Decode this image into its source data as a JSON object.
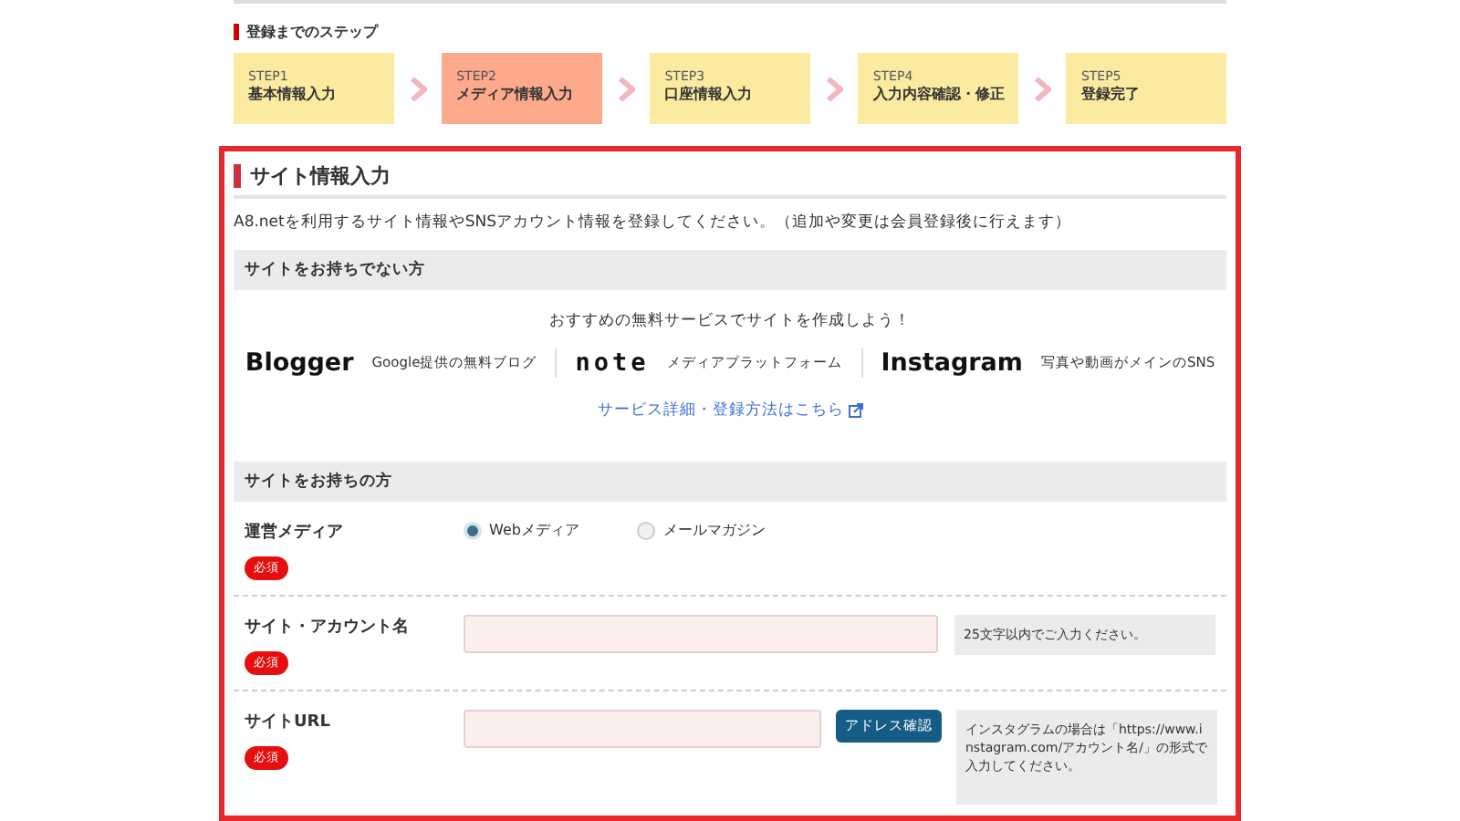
{
  "steps_heading": "登録までのステップ",
  "steps": [
    {
      "label": "STEP1",
      "title": "基本情報入力",
      "selected": false
    },
    {
      "label": "STEP2",
      "title": "メディア情報入力",
      "selected": true
    },
    {
      "label": "STEP3",
      "title": "口座情報入力",
      "selected": false
    },
    {
      "label": "STEP4",
      "title": "入力内容確認・修正",
      "selected": false
    },
    {
      "label": "STEP5",
      "title": "登録完了",
      "selected": false
    }
  ],
  "section": {
    "title": "サイト情報入力",
    "description": "A8.netを利用するサイト情報やSNSアカウント情報を登録してください。（追加や変更は会員登録後に行えます）",
    "no_site": {
      "heading": "サイトをお持ちでない方",
      "prompt": "おすすめの無料サービスでサイトを作成しよう！",
      "services": [
        {
          "name": "Blogger",
          "caption": "Google提供の無料ブログ"
        },
        {
          "name": "note",
          "caption": "メディアプラットフォーム"
        },
        {
          "name": "Instagram",
          "caption": "写真や動画がメインのSNS"
        }
      ],
      "link": "サービス詳細・登録方法はこちら"
    },
    "has_site": {
      "heading": "サイトをお持ちの方",
      "fields": [
        {
          "kind": "radio",
          "label": "運営メディア",
          "required": "必須",
          "options": [
            {
              "label": "Webメディア",
              "selected": true
            },
            {
              "label": "メールマガジン",
              "selected": false
            }
          ]
        },
        {
          "kind": "text",
          "label": "サイト・アカウント名",
          "required": "必須",
          "hint": "25文字以内でご入力ください。"
        },
        {
          "kind": "url",
          "label": "サイトURL",
          "required": "必須",
          "button": "アドレス確認",
          "hint": "インスタグラムの場合は「https://www.instagram.com/アカウント名/」の形式で入力してください。"
        }
      ]
    }
  }
}
